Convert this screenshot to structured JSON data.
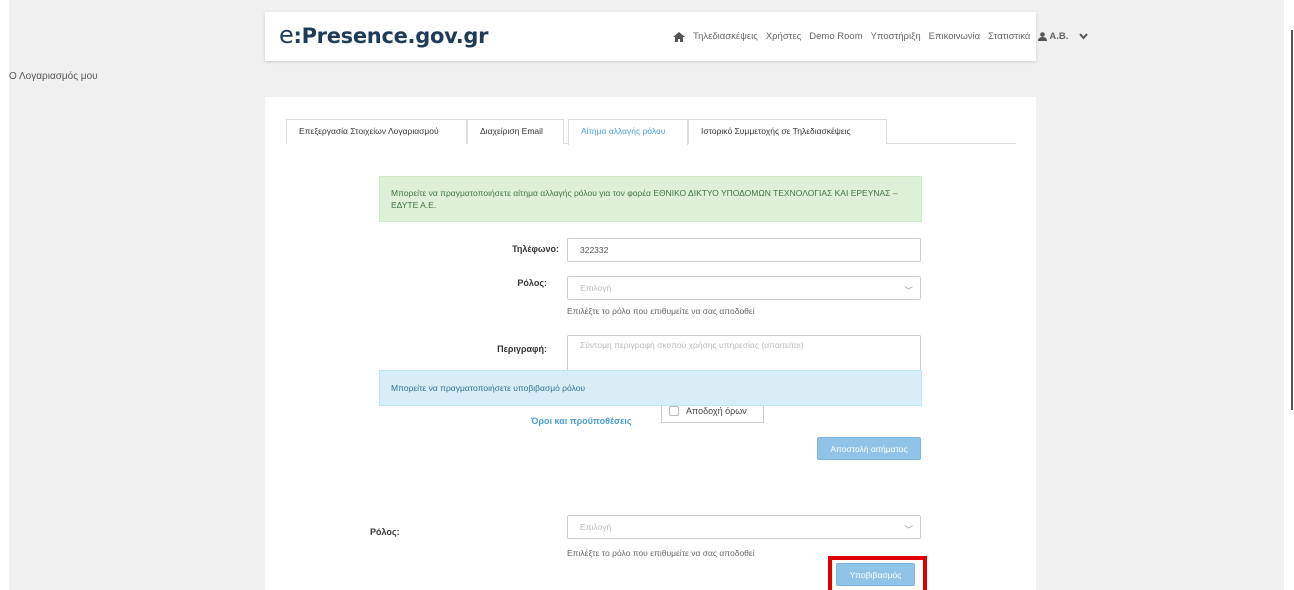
{
  "header": {
    "brand_e": "e",
    "brand_rest": ":Presence.gov.gr",
    "nav": [
      "Τηλεδιασκέψεις",
      "Χρήστες",
      "Demo Room",
      "Υποστήριξη",
      "Επικοινωνία",
      "Στατιστικά"
    ],
    "user": "Α.Β.",
    "icons": {
      "home": "home-icon",
      "user": "user-icon",
      "dropdown": "chevron-down-icon"
    }
  },
  "breadcrumb": "Ο Λογαριασμός μου",
  "tabs": [
    {
      "label": "Επεξεργασία Στοιχείων Λογαριασμού"
    },
    {
      "label": "Διαχείριση Email"
    },
    {
      "label": "Αίτημα αλλαγής ρόλου",
      "active": true
    },
    {
      "label": "Ιστορικό Συμμετοχής σε Τηλεδιασκέψεις"
    }
  ],
  "role_change": {
    "alert": "Μπορείτε να πραγματοποιήσετε αίτημα αλλαγής ρόλου για τον φορέα ΕΘΝΙΚΟ ΔΙΚΤΥΟ ΥΠΟΔΟΜΩΝ ΤΕΧΝΟΛΟΓΙΑΣ ΚΑΙ ΕΡΕΥΝΑΣ – ΕΔΥΤΕ Α.Ε.",
    "phone_label": "Τηλέφωνο:",
    "phone_value": "322332",
    "role_label": "Ρόλος:",
    "role_placeholder": "Επιλογή",
    "role_help": "Επιλέξτε το ρόλο που επιθυμείτε να σας αποδοθεί",
    "description_label": "Περιγραφή:",
    "description_placeholder": "Σύντομη περιγραφή σκοπού χρήσης υπηρεσίας (απαιτείται)",
    "terms_link": "Όροι και προϋποθέσεις",
    "terms_checkbox": "Αποδοχή όρων",
    "submit": "Αποστολή αιτήματος"
  },
  "downgrade": {
    "alert": "Μπορείτε να πραγματοποιήσετε υποβιβασμό ρόλου",
    "role_label": "Ρόλος:",
    "role_placeholder": "Επιλογή",
    "role_help": "Επιλέξτε το ρόλο που επιθυμείτε να σας αποδοθεί",
    "submit": "Υποβιβασμός"
  },
  "colors": {
    "accent": "#4a9fd8",
    "highlight": "#e00000",
    "success_bg": "#dff0d8",
    "info_bg": "#d9edf7"
  }
}
